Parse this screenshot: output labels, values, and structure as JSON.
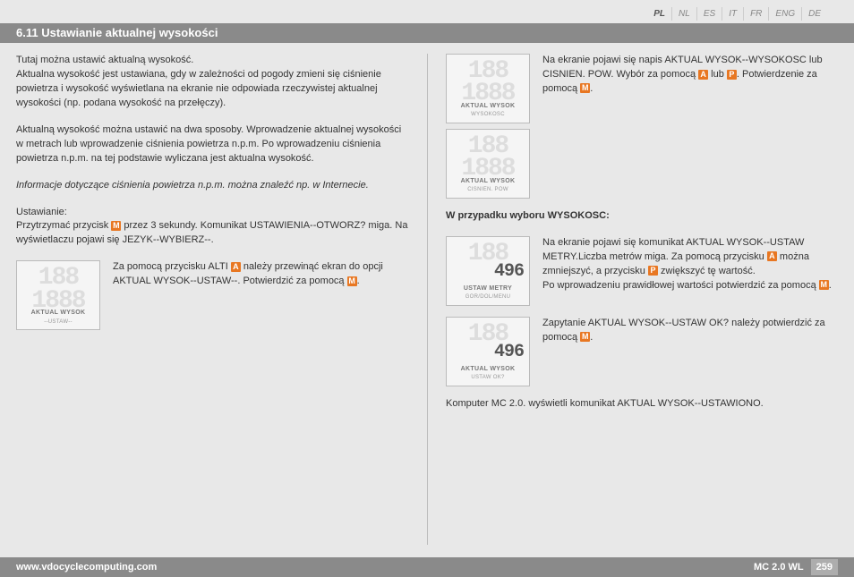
{
  "lang": {
    "items": [
      "PL",
      "NL",
      "ES",
      "IT",
      "FR",
      "ENG",
      "DE"
    ],
    "active": 0
  },
  "title": "6.11 Ustawianie aktualnej wysokości",
  "left": {
    "p1": "Tutaj można ustawić aktualną wysokość.",
    "p2": "Aktualna wysokość jest ustawiana, gdy w zależności od pogody zmieni się ciśnienie powietrza i wysokość wyświetlana na ekranie nie odpowiada rzeczywistej aktualnej wysokości (np. podana wysokość na przełęczy).",
    "p3": "Aktualną wysokość można ustawić na dwa sposoby. Wprowadzenie aktualnej wysokości w metrach lub wprowadzenie ciśnienia powietrza n.p.m. Po wprowadzeniu ciśnienia powietrza n.p.m. na tej podstawie wyliczana jest aktualna wysokość.",
    "p4": "Informacje dotyczące ciśnienia powietrza n.p.m. można znaleźć np. w Internecie.",
    "p5a": "Ustawianie:",
    "p5b_1": "Przytrzymać przycisk ",
    "p5b_2": " przez 3 sekundy. Komunikat USTAWIENIA--OTWORZ? miga. Na wyświetlaczu pojawi się JEZYK--WYBIERZ--.",
    "r1_1": "Za pomocą przycisku ALTI ",
    "r1_2": " należy przewinąć ekran do opcji AKTUAL WYSOK--USTAW--. Potwierdzić za pomocą ",
    "r1_3": ".",
    "lcd1_l1": "AKTUAL WYSOK",
    "lcd1_l2": "--USTAW--"
  },
  "right": {
    "r2_1": "Na ekranie pojawi się napis AKTUAL WYSOK--WYSOKOSC lub CISNIEN. POW. Wybór za pomocą ",
    "r2_2": " lub ",
    "r2_3": ". Potwierdzenie za pomocą ",
    "r2_4": ".",
    "lcd2a_l1": "AKTUAL WYSOK",
    "lcd2a_l2": "WYSOKOSC",
    "lcd2b_l1": "AKTUAL WYSOK",
    "lcd2b_l2": "CISNIEN. POW",
    "h1": "W przypadku wyboru WYSOKOSC:",
    "r3_1": "Na ekranie pojawi się komunikat AKTUAL WYSOK--USTAW METRY.Liczba metrów miga. Za pomocą przycisku ",
    "r3_2": " można zmniejszyć, a przycisku ",
    "r3_3": " zwiększyć tę wartość.",
    "r3_4": "Po wprowadzeniu prawidłowej wartości potwierdzić za pomocą ",
    "r3_5": ".",
    "lcd3_num": "496",
    "lcd3_l1": "USTAW METRY",
    "lcd3_l2": "GOR/DOL/MENU",
    "r4_1": "Zapytanie AKTUAL WYSOK--USTAW OK? należy potwierdzić za pomocą ",
    "r4_2": ".",
    "lcd4_num": "496",
    "lcd4_l1": "AKTUAL WYSOK",
    "lcd4_l2": "USTAW OK?",
    "p6": "Komputer MC 2.0. wyświetli komunikat AKTUAL WYSOK--USTAWIONO."
  },
  "icons": {
    "a": "A",
    "p": "P",
    "m": "M"
  },
  "footer": {
    "url": "www.vdocyclecomputing.com",
    "model": "MC 2.0 WL",
    "page": "259"
  }
}
